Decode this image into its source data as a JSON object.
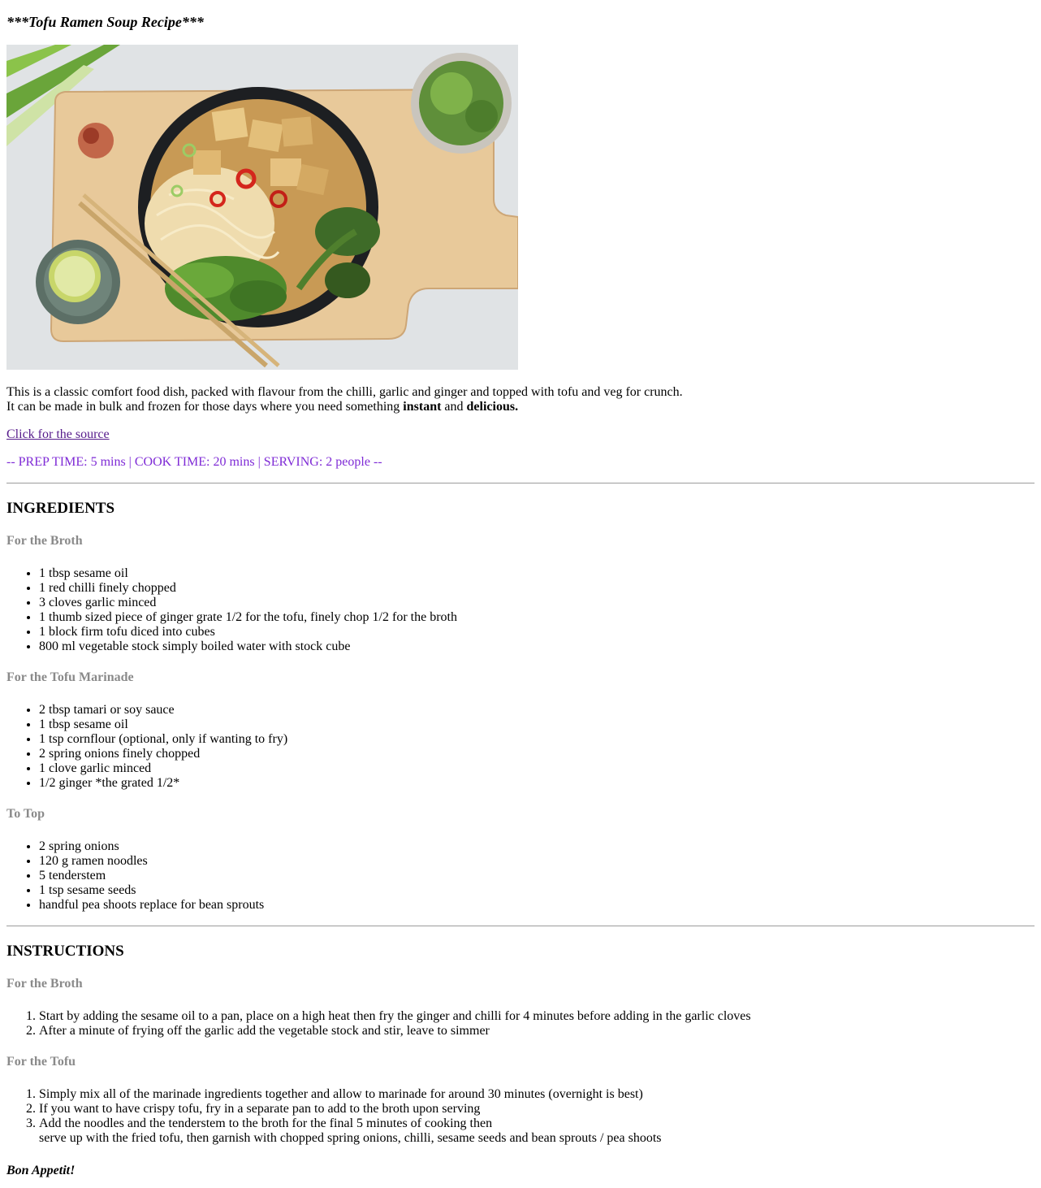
{
  "title": "***Tofu Ramen Soup Recipe***",
  "intro": {
    "line1": "This is a classic comfort food dish, packed with flavour from the chilli, garlic and ginger and topped with tofu and veg for crunch.",
    "line2_prefix": "It can be made in bulk and frozen for those days where you need something ",
    "bold1": "instant",
    "and": " and ",
    "bold2": "delicious."
  },
  "source_link": "Click for the source",
  "times": "-- PREP TIME: 5 mins | COOK TIME: 20 mins | SERVING: 2 people --",
  "ingredients": {
    "heading": "INGREDIENTS",
    "broth": {
      "heading": "For the Broth",
      "items": [
        "1 tbsp sesame oil",
        "1 red chilli finely chopped",
        "3 cloves garlic minced",
        "1 thumb sized piece of ginger grate 1/2 for the tofu, finely chop 1/2 for the broth",
        "1 block firm tofu diced into cubes",
        "800 ml vegetable stock simply boiled water with stock cube"
      ]
    },
    "marinade": {
      "heading": "For the Tofu Marinade",
      "items": [
        "2 tbsp tamari or soy sauce",
        "1 tbsp sesame oil",
        "1 tsp cornflour (optional, only if wanting to fry)",
        "2 spring onions finely chopped",
        "1 clove garlic minced",
        "1/2 ginger *the grated 1/2*"
      ]
    },
    "top": {
      "heading": "To Top",
      "items": [
        "2 spring onions",
        "120 g ramen noodles",
        "5 tenderstem",
        "1 tsp sesame seeds",
        "handful pea shoots replace for bean sprouts"
      ]
    }
  },
  "instructions": {
    "heading": "INSTRUCTIONS",
    "broth": {
      "heading": "For the Broth",
      "steps": [
        "Start by adding the sesame oil to a pan, place on a high heat then fry the ginger and chilli for 4 minutes before adding in the garlic cloves",
        "After a minute of frying off the garlic add the vegetable stock and stir, leave to simmer"
      ]
    },
    "tofu": {
      "heading": "For the Tofu",
      "steps": [
        "Simply mix all of the marinade ingredients together and allow to marinade for around 30 minutes (overnight is best)",
        "If you want to have crispy tofu, fry in a separate pan to add to the broth upon serving"
      ],
      "step3_line1": "Add the noodles and the tenderstem to the broth for the final 5 minutes of cooking then",
      "step3_line2": "serve up with the fried tofu, then garnish with chopped spring onions, chilli, sesame seeds and bean sprouts / pea shoots"
    }
  },
  "signoff": "Bon Appetit!",
  "colors": {
    "link": "#551a8b",
    "times": "#7f2bd6",
    "subheading": "#8a8a8a"
  }
}
